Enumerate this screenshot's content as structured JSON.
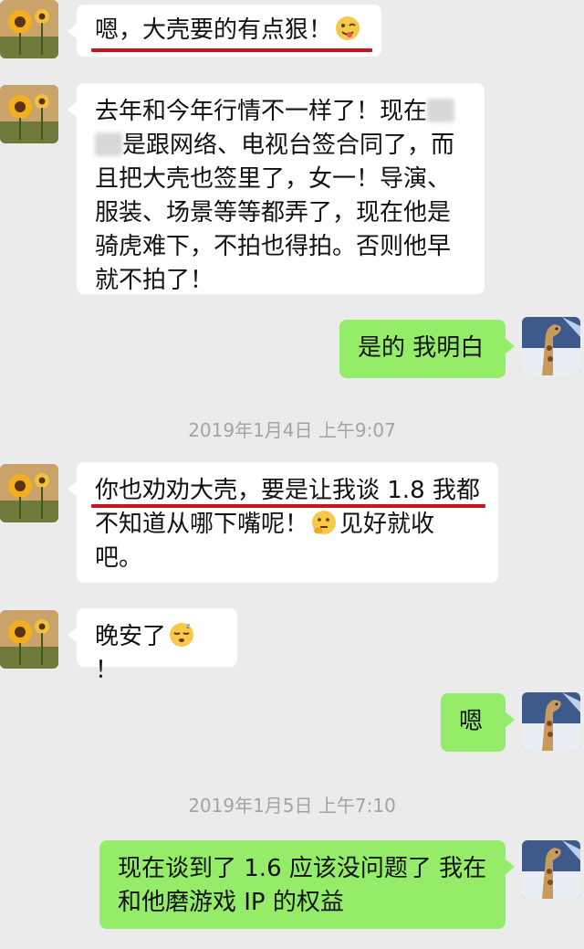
{
  "messages": [
    {
      "side": "in",
      "text": "嗯，大壳要的有点狠！"
    },
    {
      "side": "in",
      "lines": [
        "去年和今年行情不一样了！现在",
        "是跟网络、电视台签合同了，而",
        "且把大壳也签里了，女一！导演、",
        "服装、场景等等都弄了，现在他是",
        "骑虎难下，不拍也得拍。否则他早",
        "就不拍了！"
      ]
    },
    {
      "side": "out",
      "text": "是的 我明白"
    },
    {
      "side": "in",
      "lines": [
        "你也劝劝大壳，要是让我谈 1.8 我都",
        "不知道从哪下嘴呢！",
        "见好就收",
        "吧。"
      ]
    },
    {
      "side": "in",
      "text": "晚安了",
      "tail": "！"
    },
    {
      "side": "out",
      "text": "嗯"
    },
    {
      "side": "out",
      "lines": [
        "现在谈到了 1.6 应该没问题了 我在",
        "和他磨游戏 IP 的权益"
      ]
    }
  ],
  "timestamps": [
    "2019年1月4日 上午9:07",
    "2019年1月5日 上午7:10"
  ],
  "emojis": [
    "wink-tongue-emoji",
    "thinking-emoji",
    "sleeping-emoji"
  ],
  "colors": {
    "incoming": "#ffffff",
    "outgoing": "#95ec69",
    "highlight_underline": "#c8141e",
    "background": "#ebebeb"
  }
}
